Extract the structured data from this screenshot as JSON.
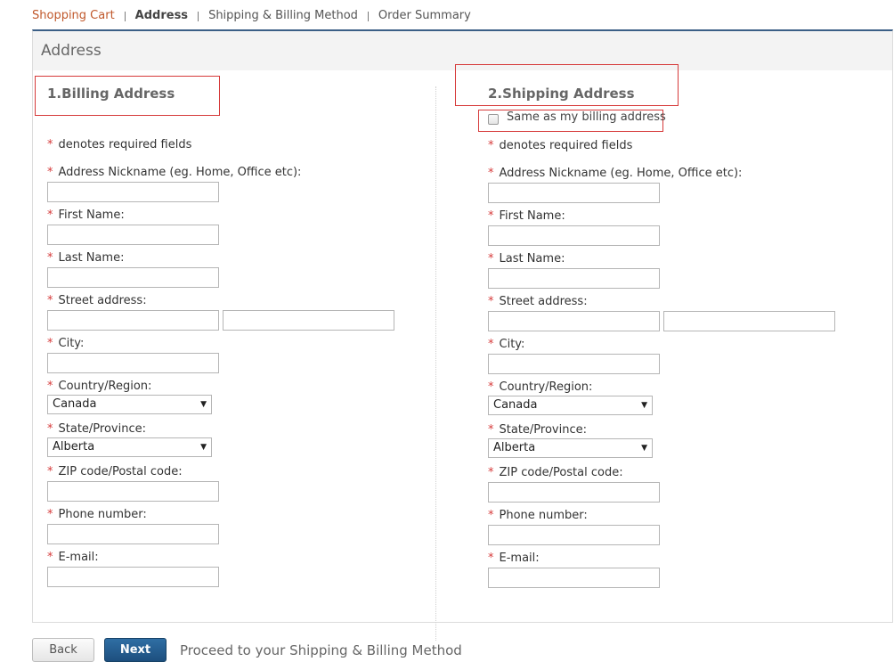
{
  "breadcrumb": {
    "steps": [
      "Shopping Cart",
      "Address",
      "Shipping & Billing Method",
      "Order Summary"
    ]
  },
  "panel": {
    "title": "Address"
  },
  "billing": {
    "title": "1.Billing Address",
    "required_note": "denotes required fields",
    "labels": {
      "nickname": "Address Nickname (eg. Home, Office etc):",
      "first_name": "First Name:",
      "last_name": "Last Name:",
      "street": "Street address:",
      "city": "City:",
      "country": "Country/Region:",
      "state": "State/Province:",
      "zip": "ZIP code/Postal code:",
      "phone": "Phone number:",
      "email": "E-mail:"
    },
    "country_value": "Canada",
    "state_value": "Alberta"
  },
  "shipping": {
    "title": "2.Shipping Address",
    "same_as_billing": "Same as my billing address",
    "required_note": "denotes required fields",
    "labels": {
      "nickname": "Address Nickname (eg. Home, Office etc):",
      "first_name": "First Name:",
      "last_name": "Last Name:",
      "street": "Street address:",
      "city": "City:",
      "country": "Country/Region:",
      "state": "State/Province:",
      "zip": "ZIP code/Postal code:",
      "phone": "Phone number:",
      "email": "E-mail:"
    },
    "country_value": "Canada",
    "state_value": "Alberta"
  },
  "footer": {
    "back_label": "Back",
    "next_label": "Next",
    "proceed_text": "Proceed to your Shipping & Billing Method"
  },
  "colors": {
    "accent_blue": "#1d4f7e",
    "required_red": "#d63a3a",
    "breadcrumb_done": "#c0582b"
  }
}
